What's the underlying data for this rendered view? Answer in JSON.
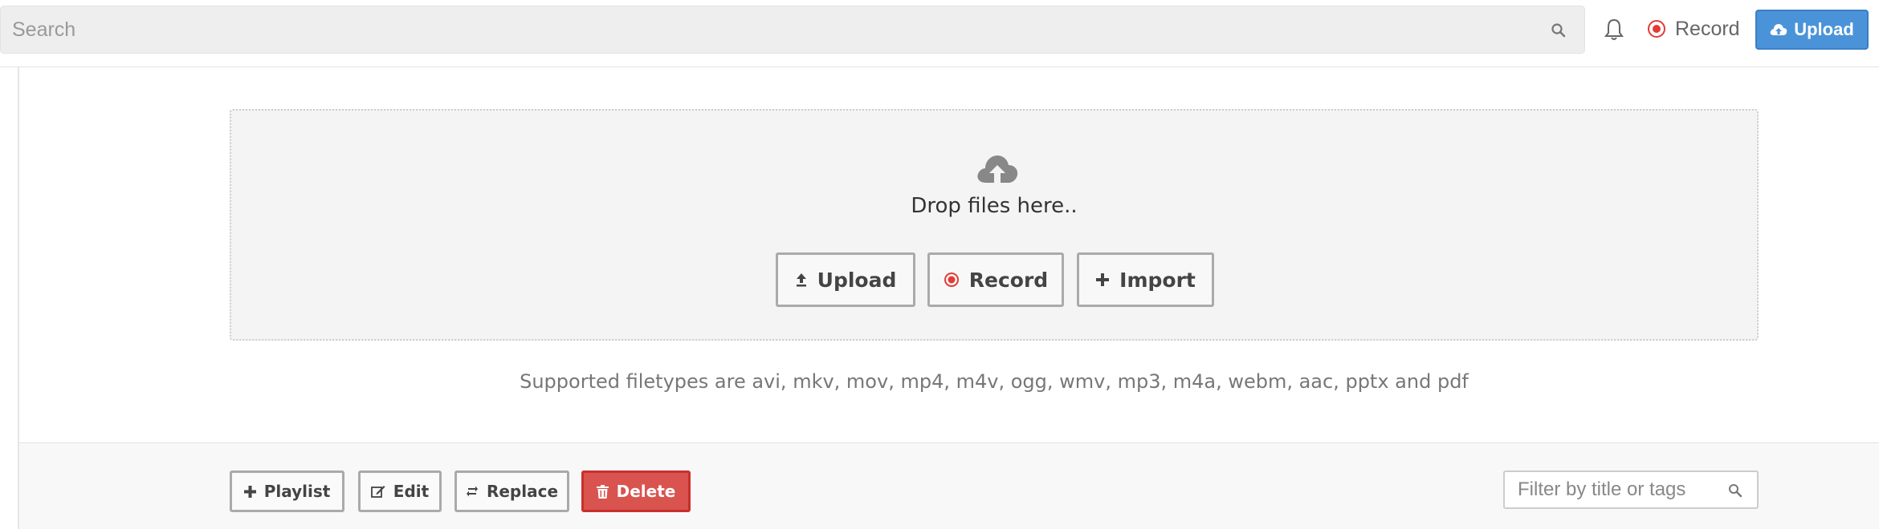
{
  "header": {
    "search_placeholder": "Search",
    "record_label": "Record",
    "upload_label": "Upload"
  },
  "dropzone": {
    "drop_text": "Drop files here..",
    "upload_label": "Upload",
    "record_label": "Record",
    "import_label": "Import",
    "supported_text": "Supported filetypes are avi, mkv, mov, mp4, m4v, ogg, wmv, mp3, m4a, webm, aac, pptx and pdf"
  },
  "toolbar": {
    "playlist_label": "Playlist",
    "edit_label": "Edit",
    "replace_label": "Replace",
    "delete_label": "Delete",
    "filter_placeholder": "Filter by title or tags"
  },
  "colors": {
    "accent": "#4a93d9",
    "record_red": "#e23b35",
    "danger": "#d9534f"
  },
  "icons": {
    "search": "search-icon",
    "bell": "bell-icon",
    "record": "record-dot-icon",
    "cloud_upload": "cloud-upload-icon",
    "upload_arrow": "upload-arrow-icon",
    "plus": "plus-icon",
    "edit": "edit-icon",
    "replace": "replace-icon",
    "trash": "trash-icon"
  }
}
